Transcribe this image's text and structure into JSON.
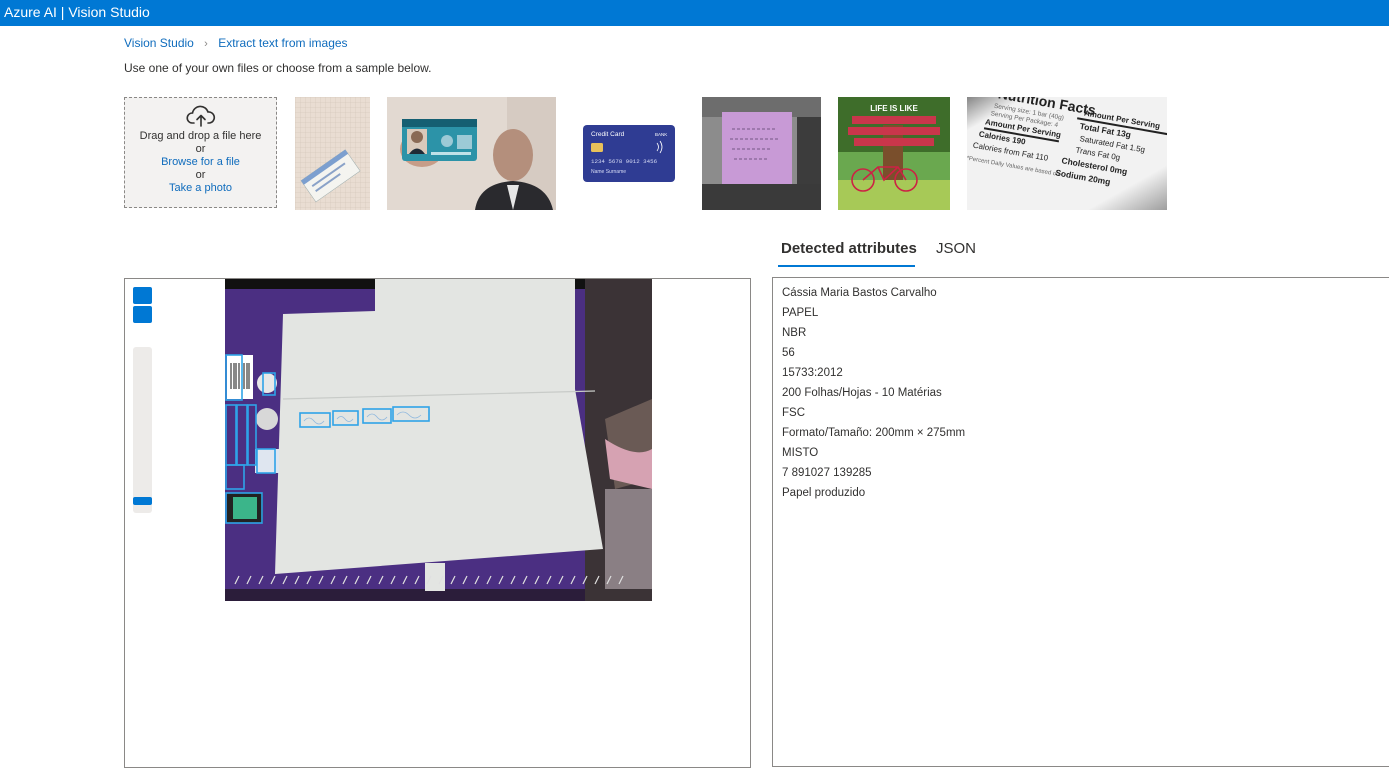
{
  "app": {
    "title": "Azure AI  |  Vision Studio"
  },
  "breadcrumb": {
    "items": [
      "Vision Studio",
      "Extract text from images"
    ]
  },
  "intro": "Use one of your own files or choose from a sample below.",
  "upload": {
    "drag_text": "Drag and drop a file here",
    "or1": "or",
    "browse_link": "Browse for a file",
    "or2": "or",
    "photo_link": "Take a photo"
  },
  "samples": [
    {
      "name": "social-security-card"
    },
    {
      "name": "id-card-held-by-man"
    },
    {
      "name": "credit-card",
      "card_label": "Credit Card",
      "card_number": "1234  5678  9012  3456",
      "card_name": "Name Surname"
    },
    {
      "name": "sticky-note-handwriting"
    },
    {
      "name": "life-is-like-a-bicycle-poster"
    },
    {
      "name": "nutrition-facts-label",
      "heading": "Nutrition Facts",
      "left_col": [
        "Serving size: 1 bar (40g)",
        "Serving Per Package: 4",
        "Amount Per Serving",
        "Calories 190",
        "Calories from Fat 110",
        "*Percent Daily Values are based on"
      ],
      "right_col": [
        "Amount Per Serving",
        "Total Fat 13g",
        "Saturated Fat 1.5g",
        "Trans Fat 0g",
        "Cholesterol 0mg",
        "Sodium 20mg"
      ]
    }
  ],
  "tabs": [
    {
      "label": "Detected attributes",
      "active": true
    },
    {
      "label": "JSON",
      "active": false
    }
  ],
  "detected_lines": [
    "Cássia Maria Bastos Carvalho",
    "PAPEL",
    "NBR",
    "56",
    "15733:2012",
    "200 Folhas/Hojas - 10 Matérias",
    "FSC",
    "Formato/Tamaño: 200mm × 275mm",
    "MISTO",
    "7 891027 139285",
    "Papel produzido"
  ],
  "zoom": {
    "level": 0.05
  },
  "colors": {
    "accent": "#0078d4",
    "link": "#0f6cbd"
  }
}
